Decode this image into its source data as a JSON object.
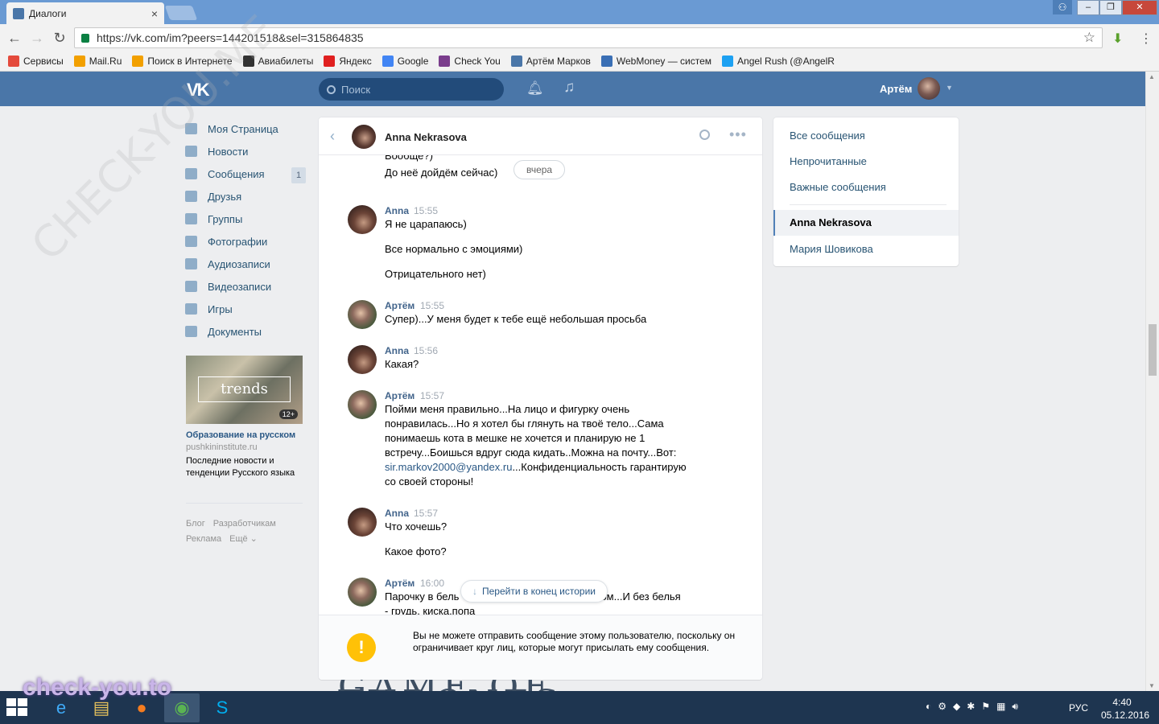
{
  "browser": {
    "tab_title": "Диалоги",
    "tab_close": "×",
    "url": "https://vk.com/im?peers=144201518&sel=315864835",
    "bookmarks": [
      {
        "label": "Сервисы",
        "color": "#e44a3c"
      },
      {
        "label": "Mail.Ru",
        "color": "#f2a000"
      },
      {
        "label": "Поиск в Интернете",
        "color": "#f2a000"
      },
      {
        "label": "Авиабилеты",
        "color": "#333333"
      },
      {
        "label": "Яндекс",
        "color": "#e02020"
      },
      {
        "label": "Google",
        "color": "#4285f4"
      },
      {
        "label": "Check You",
        "color": "#7a3d8c"
      },
      {
        "label": "Артём Марков",
        "color": "#4a76a8"
      },
      {
        "label": "WebMoney — систем",
        "color": "#3a6fb5"
      },
      {
        "label": "Angel Rush (@AngelR",
        "color": "#1da1f2"
      }
    ]
  },
  "vk": {
    "logo": "VK",
    "search_placeholder": "Поиск",
    "user_name": "Артём",
    "menu": [
      {
        "label": "Моя Страница",
        "icon": "home-icon"
      },
      {
        "label": "Новости",
        "icon": "news-icon"
      },
      {
        "label": "Сообщения",
        "icon": "messages-icon",
        "badge": "1"
      },
      {
        "label": "Друзья",
        "icon": "friends-icon"
      },
      {
        "label": "Группы",
        "icon": "groups-icon"
      },
      {
        "label": "Фотографии",
        "icon": "photos-icon"
      },
      {
        "label": "Аудиозаписи",
        "icon": "music-icon"
      },
      {
        "label": "Видеозаписи",
        "icon": "video-icon"
      },
      {
        "label": "Игры",
        "icon": "games-icon"
      },
      {
        "label": "Документы",
        "icon": "documents-icon"
      }
    ],
    "promo": {
      "image_text": "trends",
      "age": "12+",
      "title": "Образование на русском",
      "host": "pushkininstitute.ru",
      "desc": "Последние новости и тенденции Русского языка"
    },
    "footer_links": [
      "Блог",
      "Разработчикам",
      "Реклама",
      "Ещё ⌄"
    ]
  },
  "dialog": {
    "peer_name": "Anna Nekrasova",
    "top_cut_text": "Вообще?)",
    "top_message": "До неё дойдём сейчас)",
    "date_divider": "вчера",
    "groups": [
      {
        "author": "Anna",
        "time": "15:55",
        "lines": [
          "Я не царапаюсь)",
          "Все нормально с эмоциями)",
          "Отрицательного нет)"
        ]
      },
      {
        "author": "Артём",
        "time": "15:55",
        "lines": [
          "Супер)...У меня будет к тебе ещё небольшая просьба"
        ]
      },
      {
        "author": "Anna",
        "time": "15:56",
        "lines": [
          "Какая?"
        ]
      },
      {
        "author": "Артём",
        "time": "15:57",
        "lines": [
          "Пойми меня правильно...На лицо и фигурку очень",
          "понравилась...Но я хотел бы глянуть на твоё тело...Сама",
          "понимаешь кота в мешке не хочется и планирую не 1",
          "встречу...Боишься вдруг сюда кидать..Можна на почту...Вот:"
        ],
        "email": "sir.markov2000@yandex.ru",
        "email_tail": "...Конфиденциальность гарантирую",
        "last_line": "со своей стороны!"
      },
      {
        "author": "Anna",
        "time": "15:57",
        "lines": [
          "Что хочешь?",
          "Какое фото?"
        ]
      },
      {
        "author": "Артём",
        "time": "16:00",
        "line_left": "Парочку в бель",
        "line_right": "ом...И без белья",
        "line2": "- грудь, киска,попа"
      }
    ],
    "jump_label": "Перейти в конец истории",
    "footer_warning": "Вы не можете отправить сообщение этому пользователю, поскольку он ограничивает круг лиц, которые могут присылать ему сообщения."
  },
  "filters": {
    "items": [
      "Все сообщения",
      "Непрочитанные",
      "Важные сообщения"
    ],
    "active": "Anna Nekrasova",
    "other": "Мария Шовикова"
  },
  "taskbar": {
    "language": "РУС",
    "time": "4:40",
    "date": "05.12.2016"
  },
  "watermark": "check-you.to",
  "diagonal_watermark": "CHECK-YOU.ME",
  "background_art": "GAME OF THRONES",
  "colors": {
    "vk_blue": "#4a76a8",
    "link": "#2a5885",
    "warning": "#ffc107"
  }
}
